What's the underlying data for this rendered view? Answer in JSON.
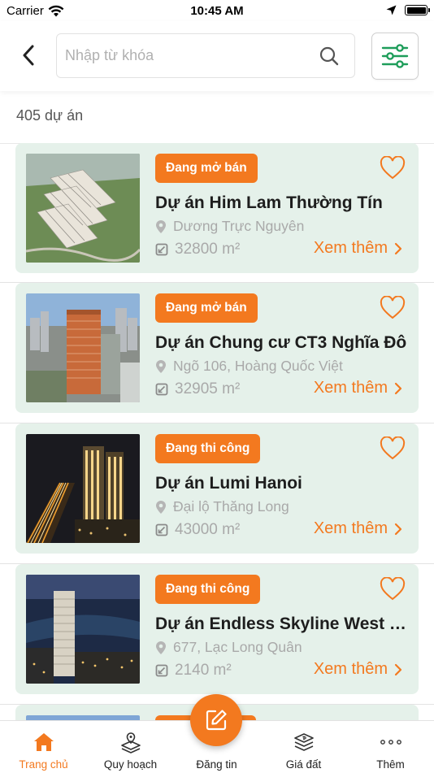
{
  "status_bar": {
    "carrier": "Carrier",
    "time": "10:45 AM"
  },
  "header": {
    "search_placeholder": "Nhập từ khóa"
  },
  "result_count": "405 dự án",
  "colors": {
    "accent": "#f3791f",
    "card_bg": "#e5f1ea"
  },
  "projects": [
    {
      "status": "Đang mở bán",
      "title": "Dự án Him Lam Thường Tín",
      "address": "Dương Trực Nguyên",
      "area": "32800 m²",
      "more": "Xem thêm"
    },
    {
      "status": "Đang mở bán",
      "title": "Dự án Chung cư CT3 Nghĩa Đô",
      "address": "Ngõ 106, Hoàng Quốc Việt",
      "area": "32905 m²",
      "more": "Xem thêm"
    },
    {
      "status": "Đang thi công",
      "title": "Dự án Lumi Hanoi",
      "address": "Đại lộ Thăng Long",
      "area": "43000 m²",
      "more": "Xem thêm"
    },
    {
      "status": "Đang thi công",
      "title": "Dự án Endless Skyline West L...",
      "address": "677, Lạc Long Quân",
      "area": "2140 m²",
      "more": "Xem thêm"
    }
  ],
  "tabbar": {
    "tabs": [
      {
        "label": "Trang chủ",
        "icon": "home-icon",
        "active": true
      },
      {
        "label": "Quy hoạch",
        "icon": "map-layers-icon"
      },
      {
        "label": "Đăng tin",
        "icon": "edit-icon"
      },
      {
        "label": "Giá đất",
        "icon": "price-layers-icon"
      },
      {
        "label": "Thêm",
        "icon": "more-dots-icon"
      }
    ]
  }
}
